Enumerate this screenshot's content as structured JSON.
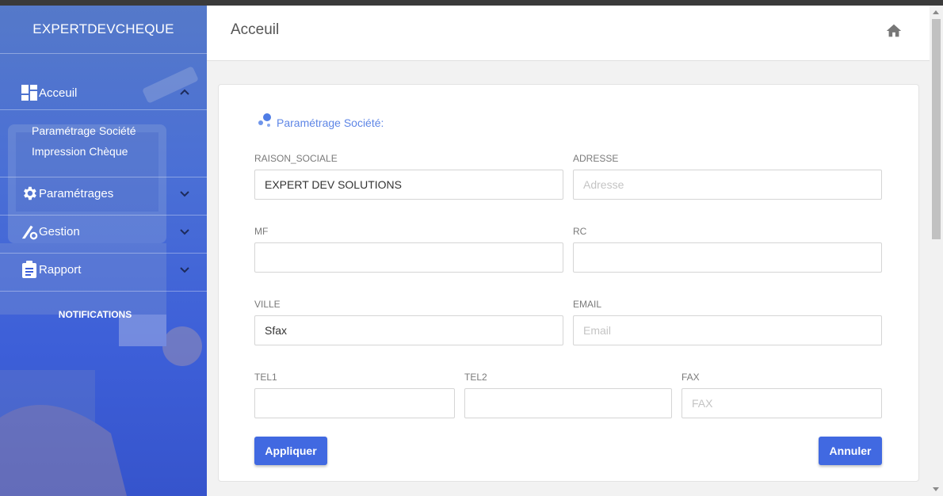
{
  "sidebar": {
    "brand": "EXPERTDEVCHEQUE",
    "items": [
      {
        "label": "Acceuil",
        "icon": "dashboard-icon",
        "chevron": "chevron-up-icon"
      },
      {
        "label": "Paramétrages",
        "icon": "gear-icon",
        "chevron": "chevron-down-icon"
      },
      {
        "label": "Gestion",
        "icon": "settings-pen-icon",
        "chevron": "chevron-down-icon"
      },
      {
        "label": "Rapport",
        "icon": "clipboard-icon",
        "chevron": "chevron-down-icon"
      }
    ],
    "sub_items": [
      "Paramétrage Société",
      "Impression Chèque"
    ],
    "notifications": "NOTIFICATIONS"
  },
  "header": {
    "title": "Acceuil",
    "icon": "home-icon"
  },
  "form": {
    "title": "Paramétrage Société:",
    "fields": {
      "raison_sociale": {
        "label": "RAISON_SOCIALE",
        "value": "EXPERT DEV SOLUTIONS",
        "placeholder": ""
      },
      "adresse": {
        "label": "ADRESSE",
        "value": "",
        "placeholder": "Adresse"
      },
      "mf": {
        "label": "MF",
        "value": "",
        "placeholder": ""
      },
      "rc": {
        "label": "RC",
        "value": "",
        "placeholder": ""
      },
      "ville": {
        "label": "VILLE",
        "value": "Sfax",
        "placeholder": ""
      },
      "email": {
        "label": "EMAIL",
        "value": "",
        "placeholder": "Email"
      },
      "tel1": {
        "label": "TEL1",
        "value": "",
        "placeholder": ""
      },
      "tel2": {
        "label": "TEL2",
        "value": "",
        "placeholder": ""
      },
      "fax": {
        "label": "FAX",
        "value": "",
        "placeholder": "FAX"
      }
    },
    "apply_label": "Appliquer",
    "cancel_label": "Annuler"
  },
  "colors": {
    "accent": "#4169e1",
    "sidebar": "#3d5fd8",
    "title_accent": "#5e86e6"
  }
}
